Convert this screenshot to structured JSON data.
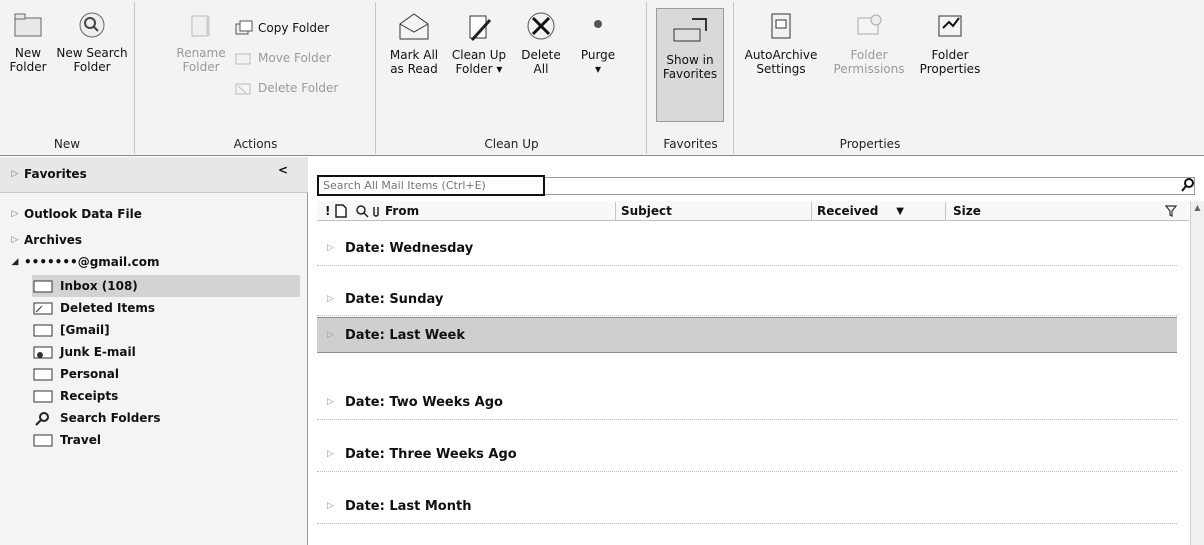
{
  "ribbon": {
    "groups": {
      "new": "New",
      "actions": "Actions",
      "cleanup": "Clean Up",
      "favorites": "Favorites",
      "properties": "Properties"
    },
    "buttons": {
      "new_folder": [
        "New",
        "Folder"
      ],
      "new_search_folder": [
        "New Search",
        "Folder"
      ],
      "rename_folder": [
        "Rename",
        "Folder"
      ],
      "copy_folder": "Copy Folder",
      "move_folder": "Move Folder",
      "delete_folder": "Delete Folder",
      "mark_all_read": [
        "Mark All",
        "as Read"
      ],
      "clean_up_folder": [
        "Clean Up",
        "Folder ▾"
      ],
      "delete_all": [
        "Delete",
        "All"
      ],
      "purge": [
        "Purge",
        "▾"
      ],
      "show_in_favorites": [
        "Show in",
        "Favorites"
      ],
      "autoarchive": [
        "AutoArchive",
        "Settings"
      ],
      "folder_permissions": [
        "Folder",
        "Permissions"
      ],
      "folder_properties": [
        "Folder",
        "Properties"
      ]
    }
  },
  "nav": {
    "favorites": "Favorites",
    "collapse": "<",
    "outlook_data_file": "Outlook Data File",
    "archives": "Archives",
    "account": "•••••••@gmail.com",
    "folders": [
      {
        "label": "Inbox (108)",
        "icon": "inbox-icon"
      },
      {
        "label": "Deleted Items",
        "icon": "deleted-items-icon"
      },
      {
        "label": "[Gmail]",
        "icon": "folder-icon"
      },
      {
        "label": "Junk E-mail",
        "icon": "junk-icon"
      },
      {
        "label": "Personal",
        "icon": "folder-icon"
      },
      {
        "label": "Receipts",
        "icon": "folder-icon"
      },
      {
        "label": "Search Folders",
        "icon": "search-icon"
      },
      {
        "label": "Travel",
        "icon": "folder-icon"
      }
    ]
  },
  "mail": {
    "search_placeholder": "Search All Mail Items (Ctrl+E)",
    "columns": {
      "importance": "!",
      "from": "From",
      "subject": "Subject",
      "received": "Received",
      "size": "Size"
    },
    "groups": [
      "Date: Wednesday",
      "Date: Sunday",
      "Date: Last Week",
      "Date: Two Weeks Ago",
      "Date: Three Weeks Ago",
      "Date: Last Month"
    ]
  },
  "colors": {
    "ribbon_bg": "#f3f3f3",
    "nav_bg": "#f4f4f4",
    "selected": "#d3d3d3"
  }
}
